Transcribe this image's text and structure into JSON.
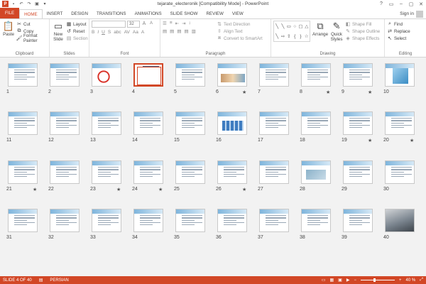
{
  "window": {
    "title": "tejarate_electeronik [Compatibility Mode] - PowerPoint",
    "controls": [
      "?",
      "▭",
      "–",
      "▢",
      "✕"
    ]
  },
  "tabs": [
    {
      "label": "FILE",
      "kind": "file"
    },
    {
      "label": "HOME",
      "kind": "active"
    },
    {
      "label": "INSERT",
      "kind": ""
    },
    {
      "label": "DESIGN",
      "kind": ""
    },
    {
      "label": "TRANSITIONS",
      "kind": ""
    },
    {
      "label": "ANIMATIONS",
      "kind": ""
    },
    {
      "label": "SLIDE SHOW",
      "kind": ""
    },
    {
      "label": "REVIEW",
      "kind": ""
    },
    {
      "label": "VIEW",
      "kind": ""
    }
  ],
  "signin_label": "Sign in",
  "ribbon": {
    "clipboard": {
      "paste": "Paste",
      "cut": "Cut",
      "copy": "Copy",
      "format_painter": "Format Painter",
      "label": "Clipboard"
    },
    "slides": {
      "new_slide": "New",
      "new_slide_2": "Slide",
      "layout": "Layout",
      "reset": "Reset",
      "section": "Section",
      "label": "Slides"
    },
    "font": {
      "font_size": "32",
      "label": "Font"
    },
    "paragraph": {
      "text_direction": "Text Direction",
      "align_text": "Align Text",
      "convert_smartart": "Convert to SmartArt",
      "label": "Paragraph"
    },
    "drawing": {
      "arrange": "Arrange",
      "quick_styles": "Quick",
      "quick_styles_2": "Styles",
      "shape_fill": "Shape Fill",
      "shape_outline": "Shape Outline",
      "shape_effects": "Shape Effects",
      "label": "Drawing"
    },
    "editing": {
      "find": "Find",
      "replace": "Replace",
      "select": "Select",
      "label": "Editing"
    }
  },
  "slides": {
    "selected": 4,
    "starred": [
      6,
      8,
      9,
      19,
      20,
      21,
      23,
      24,
      26
    ],
    "picture_slides": {
      "3": "ring",
      "6": "hands",
      "10": "cubes",
      "16": "blocks",
      "28": "pic",
      "40": "dark"
    },
    "items": [
      "1",
      "2",
      "3",
      "4",
      "5",
      "6",
      "7",
      "8",
      "9",
      "10",
      "11",
      "12",
      "13",
      "14",
      "15",
      "16",
      "17",
      "18",
      "19",
      "20",
      "21",
      "22",
      "23",
      "24",
      "25",
      "26",
      "27",
      "28",
      "29",
      "30",
      "31",
      "32",
      "33",
      "34",
      "35",
      "36",
      "37",
      "38",
      "39",
      "40"
    ]
  },
  "status": {
    "slide_info": "SLIDE 4 OF 40",
    "language": "PERSIAN",
    "zoom": "40 %",
    "zoom_level": 0.4
  }
}
